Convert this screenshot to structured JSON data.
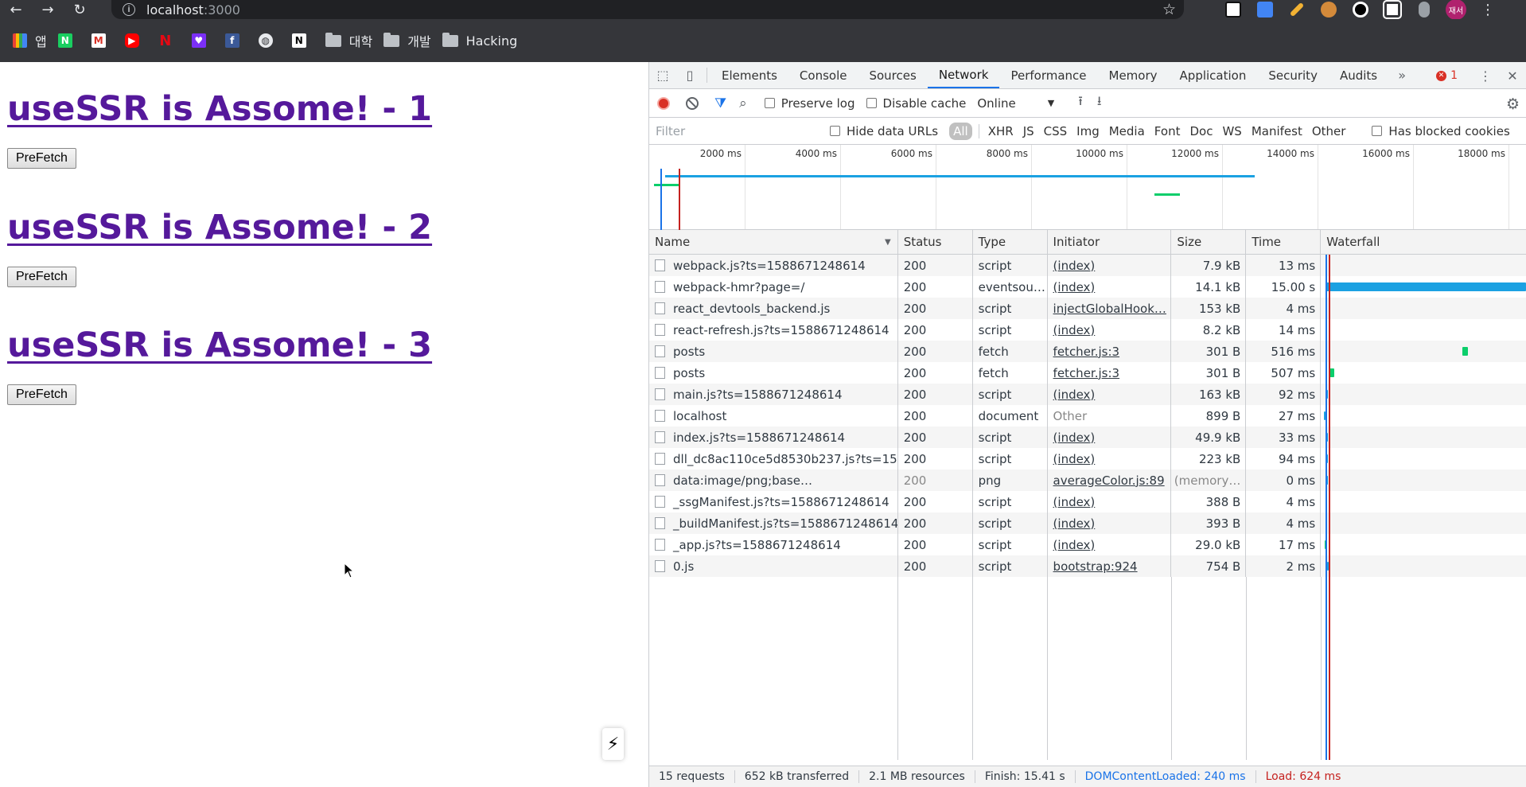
{
  "browser": {
    "url_host": "localhost",
    "url_port": ":3000",
    "nav": {
      "back": "←",
      "forward": "→",
      "reload": "↻"
    },
    "profile_initials": "재서",
    "bookmarks": [
      {
        "label": "앱",
        "icon": "apps-grid-icon"
      },
      {
        "label": "",
        "icon": "naver-icon"
      },
      {
        "label": "",
        "icon": "gmail-icon"
      },
      {
        "label": "",
        "icon": "youtube-icon"
      },
      {
        "label": "",
        "icon": "netflix-icon"
      },
      {
        "label": "",
        "icon": "heart-icon"
      },
      {
        "label": "",
        "icon": "facebook-icon"
      },
      {
        "label": "",
        "icon": "globe-icon"
      },
      {
        "label": "",
        "icon": "notion-icon"
      },
      {
        "label": "대학",
        "icon": "folder-icon"
      },
      {
        "label": "개발",
        "icon": "folder-icon"
      },
      {
        "label": "Hacking",
        "icon": "folder-icon"
      }
    ]
  },
  "page": {
    "blocks": [
      {
        "heading": "useSSR is Assome! - 1",
        "button": "PreFetch"
      },
      {
        "heading": "useSSR is Assome! - 2",
        "button": "PreFetch"
      },
      {
        "heading": "useSSR is Assome! - 3",
        "button": "PreFetch"
      }
    ]
  },
  "devtools": {
    "tabs": [
      "Elements",
      "Console",
      "Sources",
      "Network",
      "Performance",
      "Memory",
      "Application",
      "Security",
      "Audits"
    ],
    "active_tab": "Network",
    "error_count": "1",
    "toolbar": {
      "preserve_log": "Preserve log",
      "disable_cache": "Disable cache",
      "throttle": "Online"
    },
    "filter": {
      "placeholder": "Filter",
      "hide_data_urls": "Hide data URLs",
      "types": [
        "All",
        "XHR",
        "JS",
        "CSS",
        "Img",
        "Media",
        "Font",
        "Doc",
        "WS",
        "Manifest",
        "Other"
      ],
      "has_blocked_cookies": "Has blocked cookies"
    },
    "overview_ticks": [
      "2000 ms",
      "4000 ms",
      "6000 ms",
      "8000 ms",
      "10000 ms",
      "12000 ms",
      "14000 ms",
      "16000 ms",
      "18000 ms"
    ],
    "columns": [
      "Name",
      "Status",
      "Type",
      "Initiator",
      "Size",
      "Time",
      "Waterfall"
    ],
    "requests": [
      {
        "name": "webpack.js?ts=1588671248614",
        "status": "200",
        "type": "script",
        "initiator": "(index)",
        "size": "7.9 kB",
        "time": "13 ms"
      },
      {
        "name": "webpack-hmr?page=/",
        "status": "200",
        "type": "eventsou…",
        "initiator": "(index)",
        "size": "14.1 kB",
        "time": "15.00 s"
      },
      {
        "name": "react_devtools_backend.js",
        "status": "200",
        "type": "script",
        "initiator": "injectGlobalHook…",
        "size": "153 kB",
        "time": "4 ms"
      },
      {
        "name": "react-refresh.js?ts=1588671248614",
        "status": "200",
        "type": "script",
        "initiator": "(index)",
        "size": "8.2 kB",
        "time": "14 ms"
      },
      {
        "name": "posts",
        "status": "200",
        "type": "fetch",
        "initiator": "fetcher.js:3",
        "size": "301 B",
        "time": "516 ms"
      },
      {
        "name": "posts",
        "status": "200",
        "type": "fetch",
        "initiator": "fetcher.js:3",
        "size": "301 B",
        "time": "507 ms"
      },
      {
        "name": "main.js?ts=1588671248614",
        "status": "200",
        "type": "script",
        "initiator": "(index)",
        "size": "163 kB",
        "time": "92 ms"
      },
      {
        "name": "localhost",
        "status": "200",
        "type": "document",
        "initiator": "Other",
        "size": "899 B",
        "time": "27 ms"
      },
      {
        "name": "index.js?ts=1588671248614",
        "status": "200",
        "type": "script",
        "initiator": "(index)",
        "size": "49.9 kB",
        "time": "33 ms"
      },
      {
        "name": "dll_dc8ac110ce5d8530b237.js?ts=15…",
        "status": "200",
        "type": "script",
        "initiator": "(index)",
        "size": "223 kB",
        "time": "94 ms"
      },
      {
        "name": "data:image/png;base…",
        "status": "200",
        "type": "png",
        "initiator": "averageColor.js:89",
        "size": "(memory…",
        "time": "0 ms"
      },
      {
        "name": "_ssgManifest.js?ts=1588671248614",
        "status": "200",
        "type": "script",
        "initiator": "(index)",
        "size": "388 B",
        "time": "4 ms"
      },
      {
        "name": "_buildManifest.js?ts=1588671248614",
        "status": "200",
        "type": "script",
        "initiator": "(index)",
        "size": "393 B",
        "time": "4 ms"
      },
      {
        "name": "_app.js?ts=1588671248614",
        "status": "200",
        "type": "script",
        "initiator": "(index)",
        "size": "29.0 kB",
        "time": "17 ms"
      },
      {
        "name": "0.js",
        "status": "200",
        "type": "script",
        "initiator": "bootstrap:924",
        "size": "754 B",
        "time": "2 ms"
      }
    ],
    "summary": {
      "requests": "15 requests",
      "transferred": "652 kB transferred",
      "resources": "2.1 MB resources",
      "finish": "Finish: 15.41 s",
      "dom_content_loaded": "DOMContentLoaded: 240 ms",
      "load": "Load: 624 ms"
    }
  }
}
